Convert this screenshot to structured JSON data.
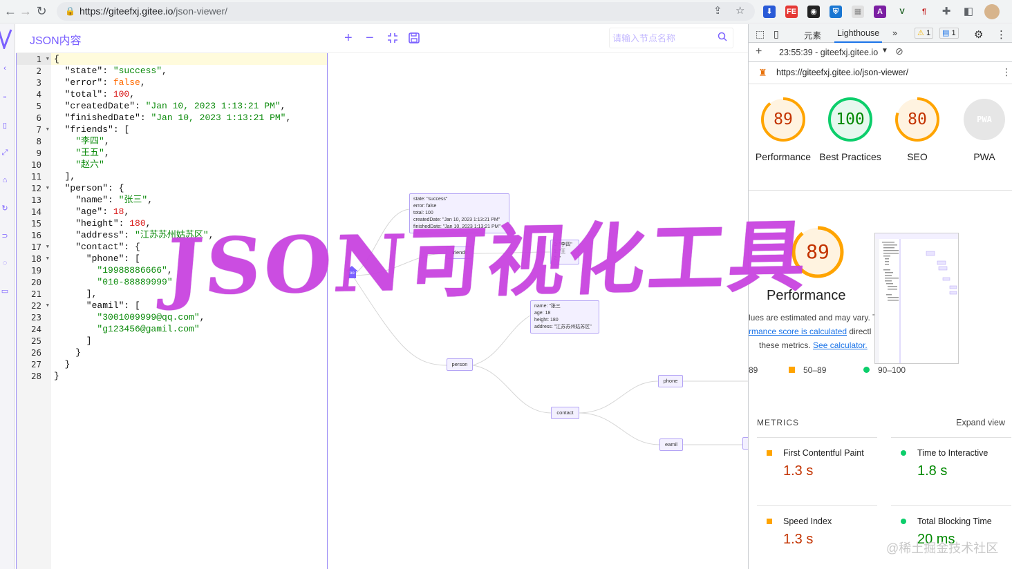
{
  "browser": {
    "url_host": "https://giteefxj.gitee.io",
    "url_path": "/json-viewer/"
  },
  "app": {
    "title": "JSON内容",
    "search_placeholder": "请输入节点名称"
  },
  "editor": {
    "line_numbers": [
      "1",
      "2",
      "3",
      "4",
      "5",
      "6",
      "7",
      "8",
      "9",
      "10",
      "11",
      "12",
      "13",
      "14",
      "15",
      "16",
      "17",
      "18",
      "19",
      "20",
      "21",
      "22",
      "23",
      "24",
      "25",
      "26",
      "27",
      "28"
    ],
    "lines": [
      [
        {
          "t": "p",
          "v": "{"
        }
      ],
      [
        {
          "t": "k",
          "v": "  \"state\": "
        },
        {
          "t": "s",
          "v": "\"success\""
        },
        {
          "t": "p",
          "v": ","
        }
      ],
      [
        {
          "t": "k",
          "v": "  \"error\": "
        },
        {
          "t": "b",
          "v": "false"
        },
        {
          "t": "p",
          "v": ","
        }
      ],
      [
        {
          "t": "k",
          "v": "  \"total\": "
        },
        {
          "t": "n",
          "v": "100"
        },
        {
          "t": "p",
          "v": ","
        }
      ],
      [
        {
          "t": "k",
          "v": "  \"createdDate\": "
        },
        {
          "t": "s",
          "v": "\"Jan 10, 2023 1:13:21 PM\""
        },
        {
          "t": "p",
          "v": ","
        }
      ],
      [
        {
          "t": "k",
          "v": "  \"finishedDate\": "
        },
        {
          "t": "s",
          "v": "\"Jan 10, 2023 1:13:21 PM\""
        },
        {
          "t": "p",
          "v": ","
        }
      ],
      [
        {
          "t": "k",
          "v": "  \"friends\": ["
        }
      ],
      [
        {
          "t": "s",
          "v": "    \"李四\""
        },
        {
          "t": "p",
          "v": ","
        }
      ],
      [
        {
          "t": "s",
          "v": "    \"王五\""
        },
        {
          "t": "p",
          "v": ","
        }
      ],
      [
        {
          "t": "s",
          "v": "    \"赵六\""
        }
      ],
      [
        {
          "t": "p",
          "v": "  ],"
        }
      ],
      [
        {
          "t": "k",
          "v": "  \"person\": {"
        }
      ],
      [
        {
          "t": "k",
          "v": "    \"name\": "
        },
        {
          "t": "s",
          "v": "\"张三\""
        },
        {
          "t": "p",
          "v": ","
        }
      ],
      [
        {
          "t": "k",
          "v": "    \"age\": "
        },
        {
          "t": "n",
          "v": "18"
        },
        {
          "t": "p",
          "v": ","
        }
      ],
      [
        {
          "t": "k",
          "v": "    \"height\": "
        },
        {
          "t": "n",
          "v": "180"
        },
        {
          "t": "p",
          "v": ","
        }
      ],
      [
        {
          "t": "k",
          "v": "    \"address\": "
        },
        {
          "t": "s",
          "v": "\"江苏苏州姑苏区\""
        },
        {
          "t": "p",
          "v": ","
        }
      ],
      [
        {
          "t": "k",
          "v": "    \"contact\": {"
        }
      ],
      [
        {
          "t": "k",
          "v": "      \"phone\": ["
        }
      ],
      [
        {
          "t": "s",
          "v": "        \"19988886666\""
        },
        {
          "t": "p",
          "v": ","
        }
      ],
      [
        {
          "t": "s",
          "v": "        \"010-88889999\""
        }
      ],
      [
        {
          "t": "p",
          "v": "      ],"
        }
      ],
      [
        {
          "t": "k",
          "v": "      \"eamil\": ["
        }
      ],
      [
        {
          "t": "s",
          "v": "        \"3001009999@qq.com\""
        },
        {
          "t": "p",
          "v": ","
        }
      ],
      [
        {
          "t": "s",
          "v": "        \"g123456@gamil.com\""
        }
      ],
      [
        {
          "t": "p",
          "v": "      ]"
        }
      ],
      [
        {
          "t": "p",
          "v": "    }"
        }
      ],
      [
        {
          "t": "p",
          "v": "  }"
        }
      ],
      [
        {
          "t": "p",
          "v": "}"
        }
      ]
    ]
  },
  "graph": {
    "root_label": "roo",
    "root_node_lines": [
      "state: \"success\"",
      "error: false",
      "total: 100",
      "createdDate: \"Jan 10, 2023 1:13:21 PM\"",
      "finishedDate: \"Jan 10, 2023 1:13:21 PM\""
    ],
    "friends_label": "friends",
    "friends_values": [
      "0: \"李四\"",
      "1: \"王",
      "2: \""
    ],
    "person_label": "person",
    "person_values": [
      "name: \"张三",
      "age: 18",
      "height: 180",
      "address: \"江苏苏州姑苏区\""
    ],
    "contact_label": "contact",
    "phone_label": "phone",
    "eamil_label": "eamil"
  },
  "devtools": {
    "tab_elements": "元素",
    "tab_lighthouse": "Lighthouse",
    "warn_count": "1",
    "info_count": "1",
    "run_label": "23:55:39 - giteefxj.gitee.io",
    "report_url": "https://giteefxj.gitee.io/json-viewer/",
    "scores": [
      {
        "value": "89",
        "label": "Performance",
        "color": "#ffa400",
        "fraction": 0.89
      },
      {
        "value": "100",
        "label": "Best Practices",
        "color": "#0cce6b",
        "fraction": 1.0
      },
      {
        "value": "80",
        "label": "SEO",
        "color": "#ffa400",
        "fraction": 0.8
      },
      {
        "value": "PWA",
        "label": "PWA",
        "color": "#ccc",
        "fraction": 0
      }
    ],
    "big_score": "89",
    "perf_heading": "Performance",
    "note1": "lues are estimated and may vary. T",
    "note2_link": "rmance score is calculated",
    "note2_rest": " directl",
    "note3": "these metrics. ",
    "note3_link": "See calculator.",
    "legend_low": "89",
    "legend_mid": "50–89",
    "legend_high": "90–100",
    "metrics_title": "METRICS",
    "expand_view": "Expand view",
    "metrics": [
      {
        "label": "First Contentful Paint",
        "value": "1.3 s",
        "color": "#ffa400",
        "value_color": "#c33300"
      },
      {
        "label": "Time to Interactive",
        "value": "1.8 s",
        "color": "#0cce6b",
        "value_color": "#008800"
      },
      {
        "label": "Speed Index",
        "value": "1.3 s",
        "color": "#ffa400",
        "value_color": "#c33300"
      },
      {
        "label": "Total Blocking Time",
        "value": "20 ms",
        "color": "#0cce6b",
        "value_color": "#008800"
      }
    ]
  },
  "overlay": {
    "title": "JSON可视化工具",
    "watermark": "@稀土掘金技术社区"
  }
}
